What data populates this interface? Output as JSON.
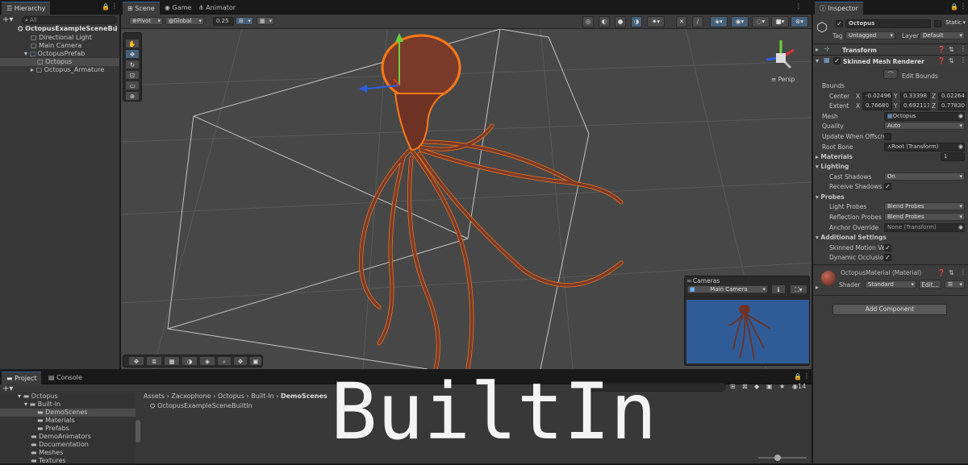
{
  "hierarchy": {
    "tab": "Hierarchy",
    "search_placeholder": "All",
    "items": [
      {
        "label": "OctopusExampleSceneBu"
      },
      {
        "label": "Directional Light"
      },
      {
        "label": "Main Camera"
      },
      {
        "label": "OctopusPrefab"
      },
      {
        "label": "Octopus"
      },
      {
        "label": "Octopus_Armature"
      }
    ]
  },
  "scene": {
    "tabs": [
      {
        "label": "Scene"
      },
      {
        "label": "Game"
      },
      {
        "label": "Animator"
      }
    ],
    "toolbar": {
      "pivot": "Pivot",
      "global": "Global",
      "grid_snap": "0.25"
    },
    "gizmo_label": "Persp",
    "overlay_title": "BuiltIn",
    "cameras_overlay": {
      "title": "Cameras",
      "camera": "Main Camera"
    }
  },
  "inspector": {
    "tab": "Inspector",
    "object_name": "Octopus",
    "static_label": "Static",
    "tag_label": "Tag",
    "tag_value": "Untagged",
    "layer_label": "Layer",
    "layer_value": "Default",
    "components": {
      "transform": "Transform",
      "smr": "Skinned Mesh Renderer"
    },
    "edit_bounds": "Edit Bounds",
    "bounds_label": "Bounds",
    "center_label": "Center",
    "extent_label": "Extent",
    "center": {
      "x": "-0.02496",
      "y": "0.33398",
      "z": "0.02264"
    },
    "extent": {
      "x": "0.76680",
      "y": "0.692113",
      "z": "0.77830"
    },
    "axis": {
      "x": "X",
      "y": "Y",
      "z": "Z"
    },
    "mesh_label": "Mesh",
    "mesh_value": "Octopus",
    "quality_label": "Quality",
    "quality_value": "Auto",
    "update_offscreen_label": "Update When Offscre",
    "root_bone_label": "Root Bone",
    "root_bone_value": "Root (Transform)",
    "materials_label": "Materials",
    "materials_count": "1",
    "lighting_label": "Lighting",
    "cast_shadows_label": "Cast Shadows",
    "cast_shadows_value": "On",
    "receive_shadows_label": "Receive Shadows",
    "probes_label": "Probes",
    "light_probes_label": "Light Probes",
    "light_probes_value": "Blend Probes",
    "reflection_probes_label": "Reflection Probes",
    "reflection_probes_value": "Blend Probes",
    "anchor_override_label": "Anchor Override",
    "anchor_override_value": "None (Transform)",
    "additional_label": "Additional Settings",
    "skinned_motion_label": "Skinned Motion Ve",
    "dynamic_occlusion_label": "Dynamic Occlusio",
    "material_name": "OctopusMaterial (Material)",
    "shader_label": "Shader",
    "shader_value": "Standard",
    "edit_label": "Edit...",
    "add_component": "Add Component"
  },
  "project": {
    "tabs": [
      {
        "label": "Project"
      },
      {
        "label": "Console"
      }
    ],
    "breadcrumb": [
      "Assets",
      "Zacxophone",
      "Octopus",
      "Built-In",
      "DemoScenes"
    ],
    "tree": [
      {
        "label": "Octopus"
      },
      {
        "label": "Built-In"
      },
      {
        "label": "DemoScenes"
      },
      {
        "label": "Materials"
      },
      {
        "label": "Prefabs"
      },
      {
        "label": "DemoAnimators"
      },
      {
        "label": "Documentation"
      },
      {
        "label": "Meshes"
      },
      {
        "label": "Textures"
      }
    ],
    "files": [
      {
        "label": "OctopusExampleSceneBuiltIn"
      }
    ],
    "count_badge": "14"
  },
  "colors": {
    "selection": "#2c5d87",
    "accent": "#ff7a1a",
    "viewport": "#474747"
  }
}
